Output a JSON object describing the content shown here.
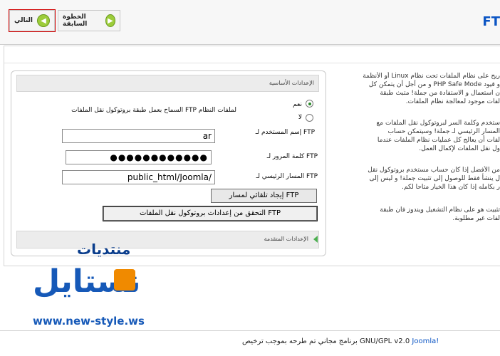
{
  "toolbar": {
    "next_label": "التالي",
    "prev_label": "الخطوة السابقة",
    "title": "FT"
  },
  "description": {
    "para1": [
      "ريح على نظام الملفات تحت نظام Linux أو الأنظمة",
      "و قيود PHP Safe Mode و من أجل أن يتمكن كل",
      "ن استعمال و الاستفادة من جملة! متبث طبقة",
      "لفات موجود لمعالجة نظام الملفات."
    ],
    "para2": [
      "ستخدم وكلمة السر لبروتوكول نقل الملفات مع",
      "المسار الرئيسي لـ جملة! وسيتمكن حساب",
      "لفات أن يعالج كل عمليات نظام الملفات عندما",
      "ول نقل الملفات لإكمال العمل."
    ],
    "para3": [
      "من الأفضل إذا كان حساب مستخدم بروتوكول نقل",
      "ل ينشأ فقط للوصول إلى تثبيت جملة! و ليس إلى",
      "ر بكامله إذا كان هذا الخيار متاحا لكم."
    ],
    "para4": [
      "تثبيت هو على نظام التشغيل ويندوز فان طبقة",
      "لفات غير مطلوبة."
    ]
  },
  "panel": {
    "title": "الإعدادات الأساسية",
    "enable_label": "السماح بعمل طبقة بروتوكول نقل الملفات FTP لملفات النظام",
    "yes_label": "نعم",
    "no_label": "لا",
    "username_label": "إسم المستخدم لـ FTP",
    "username_value": "ar",
    "password_label": "كلمة المرور لـ FTP",
    "password_value": "●●●●●●●●●●●●",
    "root_label": "المسار الرئيسي لـ FTP",
    "root_value": "public_html/Joomla/",
    "autofind_label": "إيجاد تلقائي لمسار FTP",
    "verify_label": "التحقق من إعدادات بروتوكول نقل الملفات FTP",
    "advanced_title": "الإعدادات المتقدمة"
  },
  "watermark": {
    "word": "منتديات",
    "main": "نستايل",
    "url": "www.new-style.ws"
  },
  "footer": {
    "link": "Joomla!",
    "text": "برنامج مجاني تم طرحه بموجب ترخيص GNU/GPL v2.0"
  },
  "colors": {
    "accent_blue": "#0b55c4",
    "button_green": "#9ccc3a",
    "highlight_red": "#d10000"
  }
}
